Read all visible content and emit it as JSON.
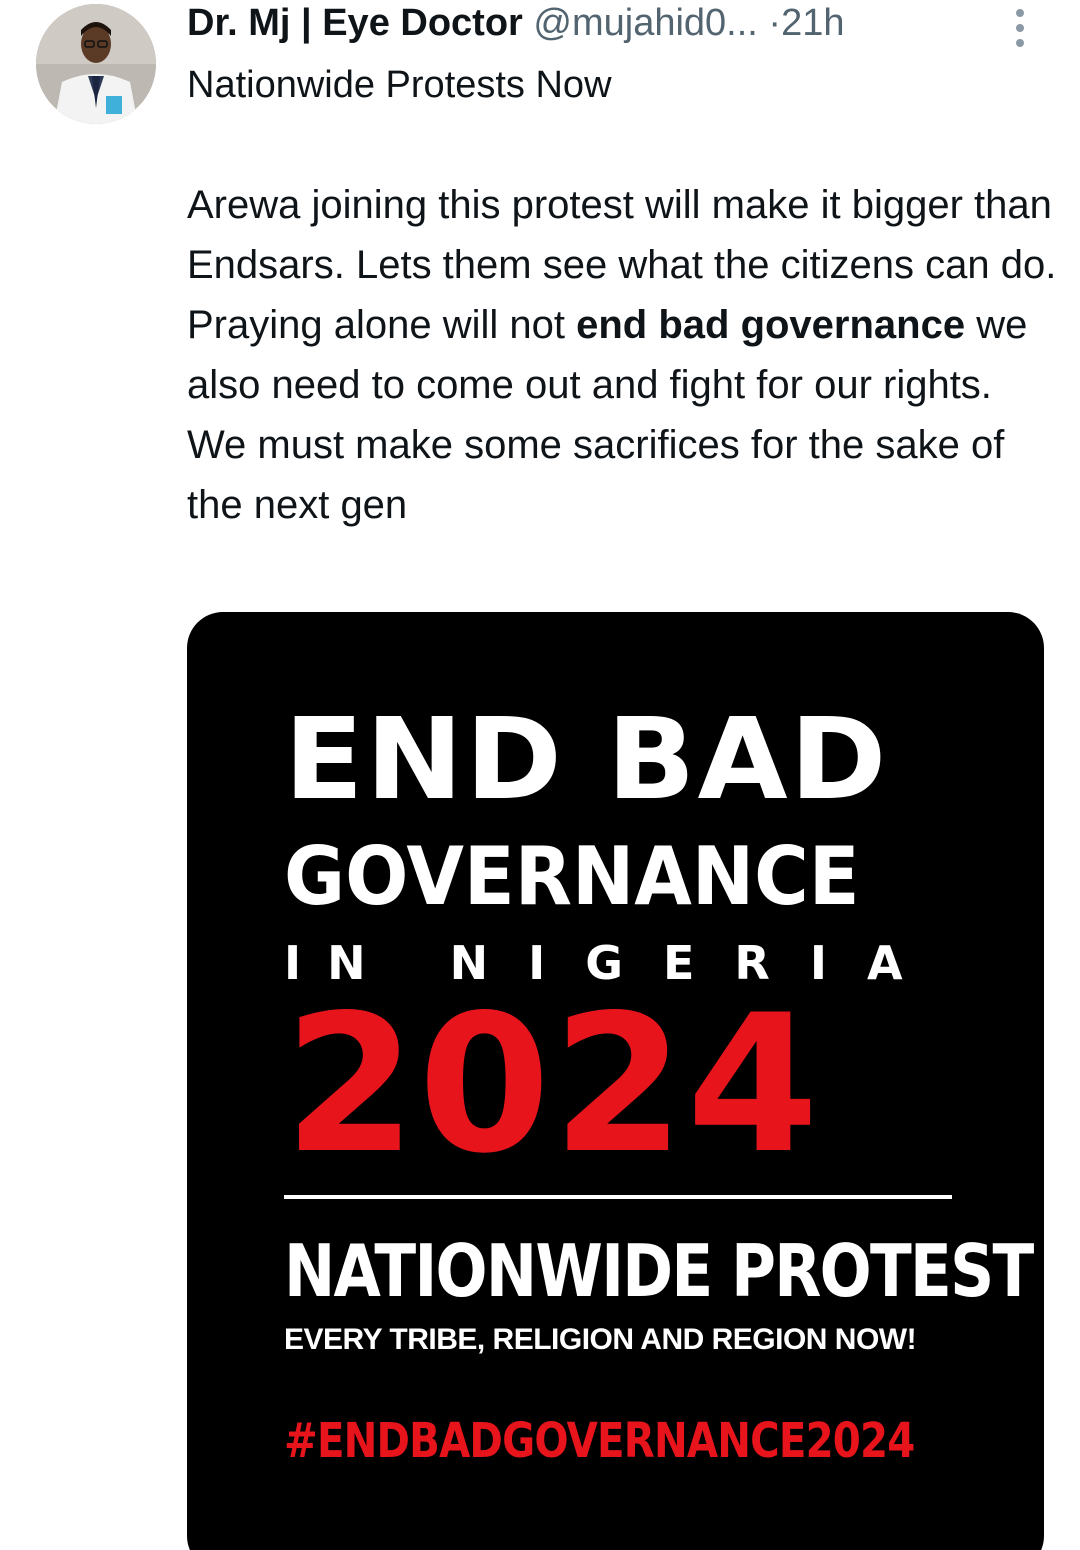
{
  "author": {
    "display_name": "Dr. Mj | Eye Doctor",
    "handle": "@mujahid0...",
    "separator": "·",
    "time": "21h"
  },
  "tweet": {
    "title": "Nationwide Protests Now",
    "body_part1": "Arewa joining this protest will make it bigger than Endsars. Lets them see what the citizens can do. Praying alone will not ",
    "body_bold": "end bad governance",
    "body_part2": " we also need to come out and fight for our rights. We must make some sacrifices for the sake of the next gen"
  },
  "poster": {
    "line1": "END BAD",
    "line2": "GOVERNANCE",
    "line3_word1": "IN",
    "line3_word2": "NIGERIA",
    "year": "2024",
    "headline": "NATIONWIDE PROTEST",
    "tagline": "EVERY TRIBE, RELIGION AND REGION NOW!",
    "hashtag": "#ENDBADGOVERNANCE2024",
    "colors": {
      "background": "#000000",
      "text": "#ffffff",
      "accent_red": "#e8141b"
    }
  },
  "icons": {
    "avatar": "doctor-profile-photo",
    "more": "more-vertical-icon"
  },
  "colors": {
    "text_primary": "#0f1419",
    "text_secondary": "#536471"
  }
}
